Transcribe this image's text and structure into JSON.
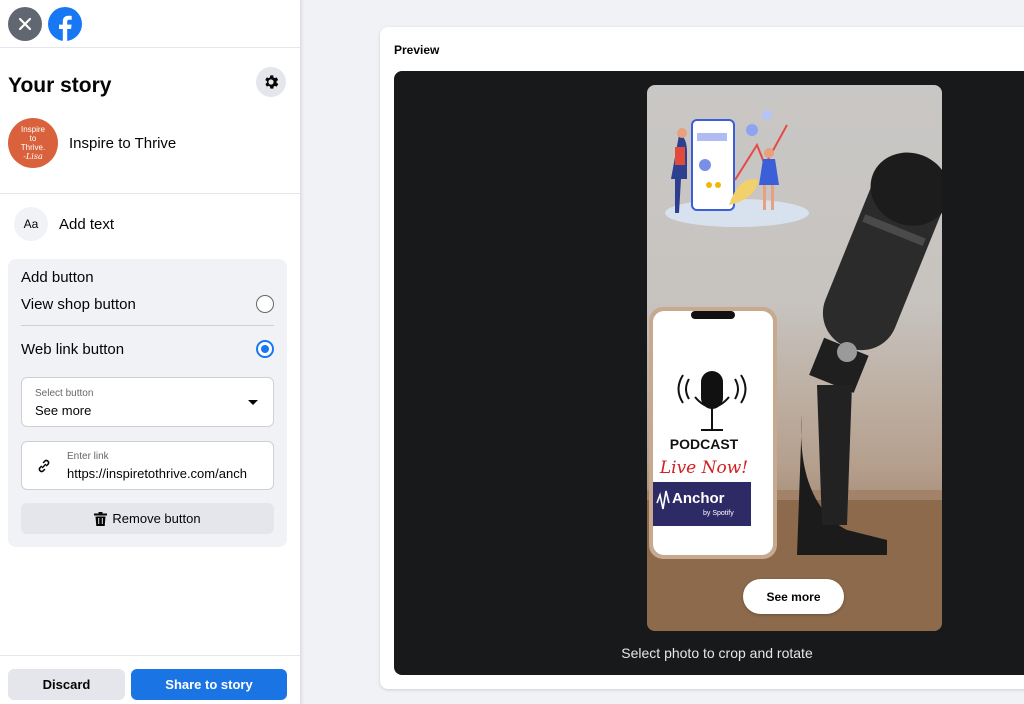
{
  "sidebar": {
    "title": "Your story",
    "page": {
      "name": "Inspire to Thrive",
      "avatar_lines": [
        "Inspire",
        "to",
        "Thrive."
      ],
      "avatar_signature": "-Lisa"
    },
    "add_text": {
      "icon_text": "Aa",
      "label": "Add text"
    },
    "add_button": {
      "heading": "Add button",
      "options": [
        {
          "label": "View shop button",
          "selected": false
        },
        {
          "label": "Web link button",
          "selected": true
        }
      ],
      "select": {
        "caption": "Select button",
        "value": "See more"
      },
      "link": {
        "caption": "Enter link",
        "value": "https://inspiretothrive.com/anch"
      },
      "remove_label": "Remove button"
    },
    "footer": {
      "discard_label": "Discard",
      "share_label": "Share to story"
    }
  },
  "preview": {
    "label": "Preview",
    "story": {
      "podcast_text": "PODCAST",
      "live_text": "Live Now!",
      "anchor_text": "Anchor",
      "anchor_sub": "by Spotify",
      "cta_label": "See more"
    },
    "crop_hint": "Select photo to crop and rotate"
  },
  "colors": {
    "brand_blue": "#1b74e4",
    "avatar_orange": "#d9623c",
    "stage_dark": "#18191a"
  }
}
